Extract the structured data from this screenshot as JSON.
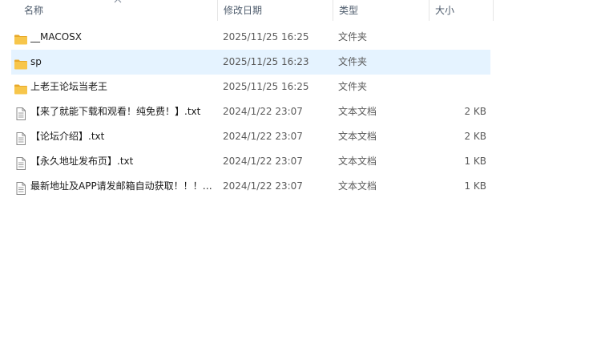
{
  "columns": {
    "name": "名称",
    "date": "修改日期",
    "type": "类型",
    "size": "大小"
  },
  "colors": {
    "selected_row": "#e5f3ff",
    "folder": "#f7c64b",
    "header_text": "#4c5a6b"
  },
  "files": [
    {
      "name": "__MACOSX",
      "date": "2025/11/25 16:25",
      "type": "文件夹",
      "size": "",
      "icon": "folder-icon",
      "selected": false
    },
    {
      "name": "sp",
      "date": "2025/11/25 16:23",
      "type": "文件夹",
      "size": "",
      "icon": "folder-icon",
      "selected": true
    },
    {
      "name": "上老王论坛当老王",
      "date": "2025/11/25 16:25",
      "type": "文件夹",
      "size": "",
      "icon": "folder-icon",
      "selected": false
    },
    {
      "name": "【来了就能下载和观看！纯免费！】.txt",
      "date": "2024/1/22 23:07",
      "type": "文本文档",
      "size": "2 KB",
      "icon": "text-file-icon",
      "selected": false
    },
    {
      "name": "【论坛介绍】.txt",
      "date": "2024/1/22 23:07",
      "type": "文本文档",
      "size": "2 KB",
      "icon": "text-file-icon",
      "selected": false
    },
    {
      "name": "【永久地址发布页】.txt",
      "date": "2024/1/22 23:07",
      "type": "文本文档",
      "size": "1 KB",
      "icon": "text-file-icon",
      "selected": false
    },
    {
      "name": "最新地址及APP请发邮箱自动获取！！！....",
      "date": "2024/1/22 23:07",
      "type": "文本文档",
      "size": "1 KB",
      "icon": "text-file-icon",
      "selected": false
    }
  ]
}
